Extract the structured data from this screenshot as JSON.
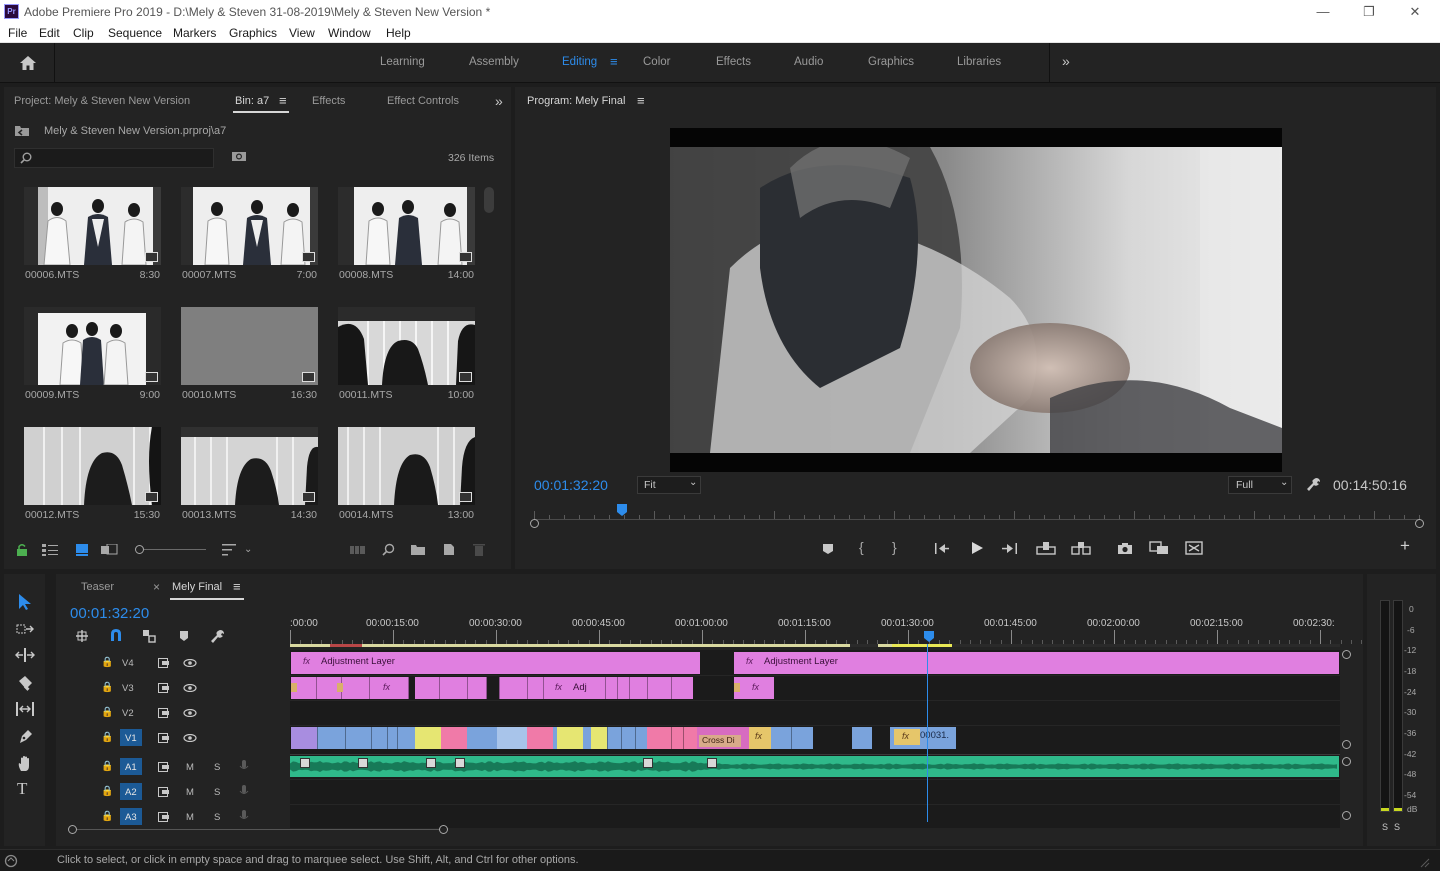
{
  "app": {
    "logo_text": "Pr",
    "window_title": "Adobe Premiere Pro 2019 - D:\\Mely & Steven 31-08-2019\\Mely & Steven New Version *",
    "window_controls": [
      "minimize-icon",
      "restore-icon",
      "close-icon"
    ]
  },
  "menu": [
    "File",
    "Edit",
    "Clip",
    "Sequence",
    "Markers",
    "Graphics",
    "View",
    "Window",
    "Help"
  ],
  "workspaces": {
    "items": [
      "Learning",
      "Assembly",
      "Editing",
      "Color",
      "Effects",
      "Audio",
      "Graphics",
      "Libraries"
    ],
    "active": "Editing",
    "more": "»"
  },
  "project_panel": {
    "tabs": [
      "Project: Mely & Steven New Version",
      "Bin: a7",
      "Effects",
      "Effect Controls"
    ],
    "active_tab": "Bin: a7",
    "path": "Mely & Steven New Version.prproj\\a7",
    "search_placeholder": "",
    "item_count": "326 Items",
    "clips": [
      {
        "name": "00006.MTS",
        "duration": "8:30"
      },
      {
        "name": "00007.MTS",
        "duration": "7:00"
      },
      {
        "name": "00008.MTS",
        "duration": "14:00"
      },
      {
        "name": "00009.MTS",
        "duration": "9:00"
      },
      {
        "name": "00010.MTS",
        "duration": "16:30"
      },
      {
        "name": "00011.MTS",
        "duration": "10:00"
      },
      {
        "name": "00012.MTS",
        "duration": "15:30"
      },
      {
        "name": "00013.MTS",
        "duration": "14:30"
      },
      {
        "name": "00014.MTS",
        "duration": "13:00"
      }
    ]
  },
  "program_monitor": {
    "title": "Program: Mely Final",
    "playhead_timecode": "00:01:32:20",
    "zoom": "Fit",
    "resolution": "Full",
    "duration_timecode": "00:14:50:16",
    "playhead_fraction": 0.099
  },
  "timeline": {
    "tabs": [
      "Teaser",
      "Mely Final"
    ],
    "active_tab": "Mely Final",
    "timecode": "00:01:32:20",
    "ruler": [
      ":00:00",
      "00:00:15:00",
      "00:00:30:00",
      "00:00:45:00",
      "00:01:00:00",
      "00:01:15:00",
      "00:01:30:00",
      "00:01:45:00",
      "00:02:00:00",
      "00:02:15:00",
      "00:02:30:"
    ],
    "video_tracks": [
      "V4",
      "V3",
      "V2",
      "V1"
    ],
    "audio_tracks": [
      "A1",
      "A2",
      "A3"
    ],
    "mute_label": "M",
    "solo_label": "S",
    "clip_labels": {
      "adjustment_1": "Adjustment Layer",
      "adjustment_2": "Adjustment Layer",
      "adj_short": "Adj",
      "cross_dissolve": "Cross Di",
      "clip_00031": "00031.",
      "fx": "fx"
    }
  },
  "audio_meter": {
    "scale": [
      "0",
      "-6",
      "-12",
      "-18",
      "-24",
      "-30",
      "-36",
      "-42",
      "-48",
      "-54",
      "dB"
    ],
    "solo_buttons": [
      "S",
      "S"
    ]
  },
  "status_bar": {
    "text": "Click to select, or click in empty space and drag to marquee select. Use Shift, Alt, and Ctrl for other options."
  },
  "colors": {
    "accent_blue": "#2d8ceb",
    "adjustment_pink": "#e07fe0",
    "video_clip_blue": "#7aa3dc",
    "video_clip_purple": "#a88de0",
    "audio_green": "#2fb98a",
    "work_area_yellow": "#d9d92a"
  }
}
